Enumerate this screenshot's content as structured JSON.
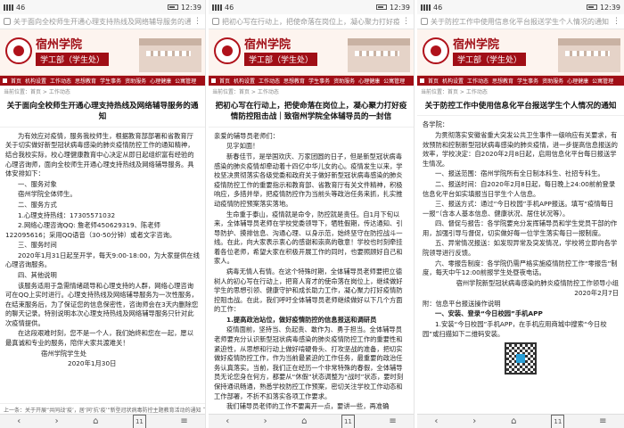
{
  "panels": [
    {
      "status": {
        "time": "12:39",
        "signal": "46"
      },
      "url": "关于面向全校师生开通心理支持热线及网络辅导服务的通知",
      "site": {
        "name": "宿州学院",
        "sub": "学工部（学生处）"
      },
      "nav": [
        "首页",
        "机构设置",
        "工作动态",
        "思想教育",
        "学生事务",
        "资助服务",
        "心理健康",
        "公寓管理"
      ],
      "crumb": "当前位置：首页 > 工作动态",
      "title": "关于面向全校师生开通心理支持热线及网络辅导服务的通知",
      "body": [
        "为有效应对疫情，服务我校师生，根据教育部部署和省教育厅关于切实做好新型冠状病毒感染的肺炎疫情防控工作的通知精神，结合我校实际，校心理健康教育中心决定从即日起组织富有经验的心理咨询师，面向全校师生开通心理支持热线及网络辅导服务。具体安排如下：",
        "一、服务对象",
        "宿州学院全体师生。",
        "二、服务方式",
        "1.心理支持热线：17305571032",
        "2.网络心理咨询QQ: 詹老师450629319、陈老师122095616；采用QQ语音（30-50分钟）或者文字咨询。",
        "三、服务时间",
        "2020年1月31日起至开学，每天9:00-18:00，为大家提供在线心理咨询服务。",
        "四、其他说明",
        "该服务适用于急需情绪疏导和心理支持的人群，网络心理咨询可在QQ上实时进行。心理支持热线及网络辅导服务为一次性服务，在结束服务后，为了保证您的信息保密性，咨询师会在3天内删除您的聊天记录。特别说明本次心理支持热线及网络辅导服务只针对此次疫情提供。",
        "在这段艰难时刻，您不是一个人，我们始终和您在一起，愿以最真诚和专业的服务，陪伴大家共渡难关！",
        "宿州学院学生处",
        "2020年1月30日"
      ],
      "footer": "上一条：关于开展“共同战‘疫’，居‘同’抗‘疫’”新型冠状病毒防控主题教育活动的通知  下一条：致全体同学一封信"
    },
    {
      "status": {
        "time": "12:39",
        "signal": "46"
      },
      "url": "把初心写在行动上，把使命落在岗位上，凝心聚力打好疫情防控阻击战",
      "site": {
        "name": "宿州学院",
        "sub": "学工部（学生处）"
      },
      "nav": [
        "首页",
        "机构设置",
        "工作动态",
        "思想教育",
        "学生事务",
        "资助服务",
        "心理健康",
        "公寓管理"
      ],
      "crumb": "当前位置：首页 > 工作动态",
      "title": "把初心写在行动上，把使命落在岗位上，凝心聚力打好疫情防控阻击战｜致宿州学院全体辅导员的一封信",
      "body": [
        "亲爱的辅导员老师们：",
        "见字如面！",
        "新春佳节，是举国欢庆、万家团圆的日子，但是新型冠状病毒感染的肺炎疫情却牵动着十四亿中华儿女的心。疫情发生以来，学校坚决贯彻落实各级党委和政府关于做好新型冠状病毒感染的肺炎疫情防控工作的重要指示和教育部、省教育厅有关文件精神，积极响应，多措并举，把疫情防控作为当前头等政治任务来抓，扎实推动疫情防控预案落实落地。",
        "生命重于泰山，疫情就是命令，防控就是责任。自1月下旬以来，全体辅导员老师在学校党委领导下，牺牲假期，传达通知、引导防护、摸排信息、沟通心理、以身示范，始终坚守在防控战斗一线。在此，向大家表示衷心的感谢和崇高的敬意！学校也时刻牵挂着各位老师，希望大家在积极开展工作的同时，也要照顾好自己和家人。",
        "病毒无情人有情。在这个特殊时期，全体辅导员老师要把立德树人的初心写在行动上，把育人育才的使命落在岗位上，继续做好学生的思想引领、健康守护和成长助力工作，凝心聚力打好疫情防控阻击战。在此，我们呼吁全体辅导员老师继续做好以下几个方面的工作：",
        "1.提高政治站位，做好疫情防控的信息报送和调研员",
        "疫情面前，坚持当、负起责、敢作为、勇于担当。全体辅导员老师要充分认识新型冠状病毒感染的肺炎疫情防控工作的重要性和紧迫性，从思想和行动上做好啃硬骨头、打攻坚战的准备，把切实做好疫情防控工作，作为当前最紧迫的工作任务，最重要的政治任务认真落实。当前，我们正在经历一个非常特殊的春假，全体辅导员无论您身在何方，都要从“休假”状态调整为“战时”状态，要时刻保持通讯畅通，熟悉学校防控工作预案，密切关注学校工作动态和工作部署，不折不扣落实各项工作要求。",
        "我们辅导员老师的工作不要离开一点，要讲一些，再准确"
      ],
      "footer": ""
    },
    {
      "status": {
        "time": "12:39",
        "signal": "46"
      },
      "url": "关于防控工作中使用信息化平台报送学生个人情况的通知",
      "site": {
        "name": "宿州学院",
        "sub": "学工部（学生处）"
      },
      "nav": [
        "首页",
        "机构设置",
        "工作动态",
        "思想教育",
        "学生事务",
        "资助服务",
        "心理健康",
        "公寓管理"
      ],
      "crumb": "当前位置：首页 > 工作动态",
      "title": "关于防控工作中使用信息化平台报送学生个人情况的通知",
      "body": [
        "各学院：",
        "为贯彻落实安徽省重大突发公共卫生事件一级响应有关要求，有效预防和控制新型冠状病毒感染的肺炎疫情，进一步提高信息报送的效率，学校决定：自2020年2月8日起，启用信息化平台每日报送学生情况。",
        "一、报送范围：宿州学院所有全日制本科生、社招专科生。",
        "二、报送时间：自2020年2月8日起，每日晚上24:00前前登录信息化平台如实填报当日学生个人信息。",
        "三、报送方式：通过“今日校园”手机APP报送。填写“疫情每日一报”（含本人基本信息、健康状况、居住状况等）。",
        "四、督促与报告：各学院要充分发挥辅导员和学生党员干部的作用，加强引导与督促，切实做好每一位学生落实每日一报制度。",
        "五、异常情况报送：如发现异常及突发情况，学校将立即向各学院领导进行反馈。",
        "六、零报告制度：各学院仍需严格实施疫情防控工作“零报告”制度，每天中午12:00前报学生处昼夜电话。",
        "宿州学院新型冠状病毒感染的肺炎疫情防控工作领导小组",
        "2020年2月7日",
        "附：信息平台报送操作说明",
        "一、安装、登录“今日校园”手机APP",
        "1.安装“今日校园”手机APP，在手机应用商城中搜索“今日校园”或扫描如下二维码安装。"
      ],
      "footer": ""
    }
  ],
  "toolbar": {
    "back": "‹",
    "forward": "›",
    "home": "⌂",
    "tabs": "11",
    "menu": "≡"
  }
}
